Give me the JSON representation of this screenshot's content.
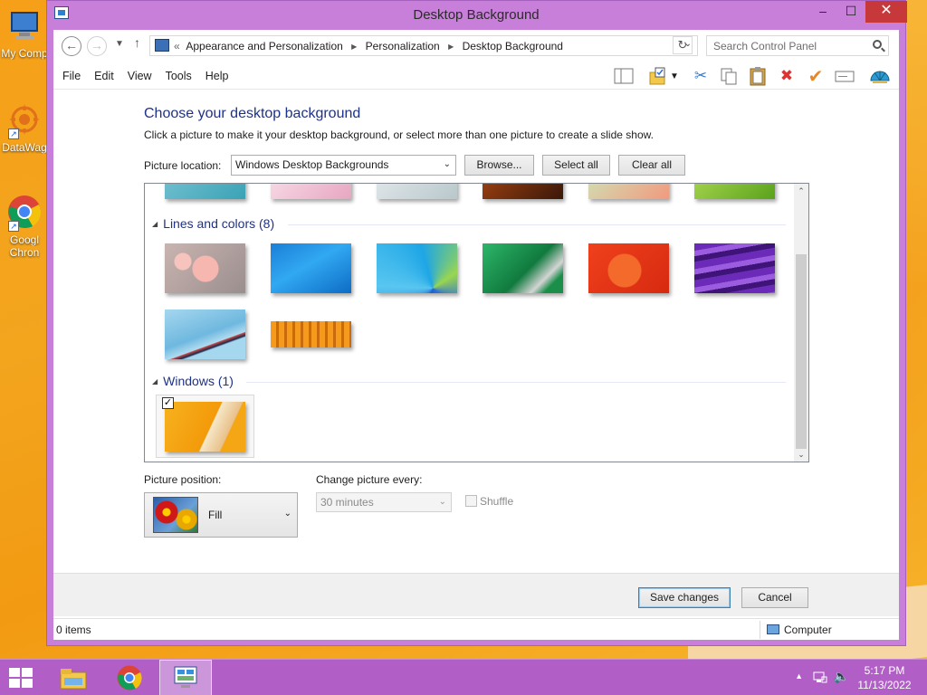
{
  "desktop": {
    "icons": [
      {
        "label": "My Comp",
        "icon": "computer-icon"
      },
      {
        "label": "DataWag",
        "icon": "datawag-icon"
      },
      {
        "label": "Googl Chron",
        "icon": "chrome-icon",
        "label_line1": "Googl",
        "label_line2": "Chron"
      }
    ]
  },
  "window": {
    "title": "Desktop Background",
    "controls": {
      "minimize": "–",
      "maximize": "☐",
      "close": "✕"
    }
  },
  "address": {
    "lead": "«",
    "crumbs": [
      "Appearance and Personalization",
      "Personalization",
      "Desktop Background"
    ],
    "search_placeholder": "Search Control Panel"
  },
  "menu": [
    "File",
    "Edit",
    "View",
    "Tools",
    "Help"
  ],
  "toolbar_icons": [
    "pane-icon",
    "folder-properties-icon",
    "cut-icon",
    "copy-icon",
    "paste-icon",
    "delete-icon",
    "check-icon",
    "rename-icon",
    "shell-icon"
  ],
  "content": {
    "heading": "Choose your desktop background",
    "subtext": "Click a picture to make it your desktop background, or select more than one picture to create a slide show.",
    "location_label": "Picture location:",
    "location_value": "Windows Desktop Backgrounds",
    "browse": "Browse...",
    "select_all": "Select all",
    "clear_all": "Clear all",
    "groups": [
      {
        "name": "Lines and colors (8)",
        "count": 8
      },
      {
        "name": "Windows (1)",
        "count": 1
      }
    ],
    "position_label": "Picture position:",
    "position_value": "Fill",
    "change_label": "Change picture every:",
    "change_value": "30 minutes",
    "shuffle": "Shuffle"
  },
  "footer": {
    "save": "Save changes",
    "cancel": "Cancel"
  },
  "status": {
    "items": "0 items",
    "location": "Computer"
  },
  "taskbar": {
    "time": "5:17 PM",
    "date": "11/13/2022"
  },
  "colors": {
    "window_frame": "#c87fd9",
    "taskbar": "#b15fc7",
    "heading": "#1e3287",
    "close": "#c7383a",
    "desktop": "#f6a019"
  }
}
